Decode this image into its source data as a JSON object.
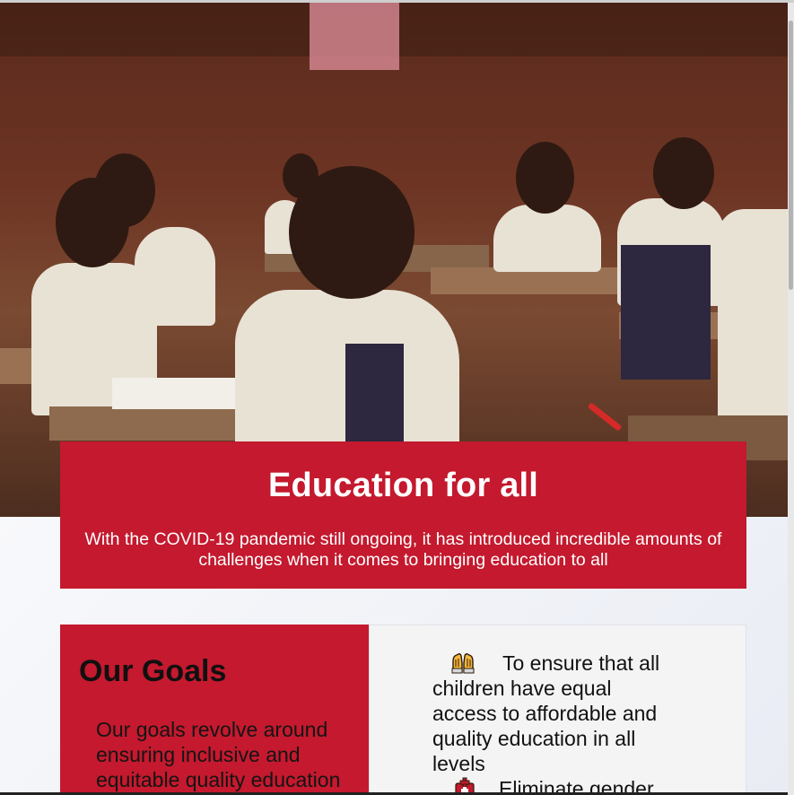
{
  "hero": {
    "image_name": "classroom-students-photo",
    "title": "Education for all",
    "text": "With the COVID-19 pandemic still ongoing, it has introduced incredible amounts of challenges when it comes to bringing education to all"
  },
  "goals": {
    "title": "Our Goals",
    "text": "Our goals revolve around ensuring inclusive and equitable quality education",
    "items": [
      {
        "icon": "raised-hands-icon",
        "text": "To ensure that all children have equal access to affordable and quality education in all levels"
      },
      {
        "icon": "medical-cross-icon",
        "text": "Eliminate gender"
      }
    ]
  },
  "colors": {
    "accent": "#c4192e",
    "panel": "#f4f4f5",
    "text": "#111111",
    "white": "#ffffff"
  }
}
